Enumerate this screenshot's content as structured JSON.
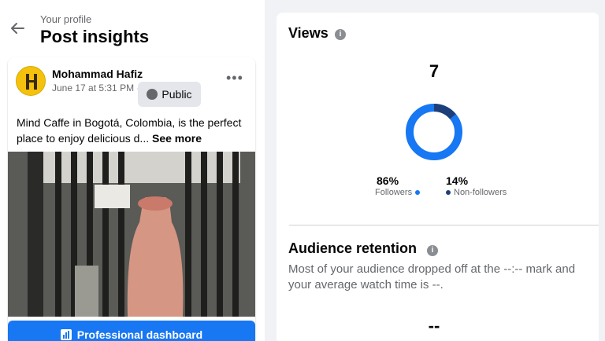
{
  "header": {
    "subtitle": "Your profile",
    "title": "Post insights"
  },
  "post": {
    "author": "Mohammad Hafiz",
    "date": "June 17 at 5:31 PM",
    "separator": "·",
    "audience": "Public",
    "text": "Mind Caffe in Bogotá, Colombia, is the perfect place to enjoy delicious d...",
    "see_more": "See more",
    "sign_text": "PUERTA DE\nCAFECITO"
  },
  "dashboard_button": {
    "label": "Professional dashboard"
  },
  "views": {
    "title": "Views",
    "total": "7",
    "followers_pct": "86%",
    "followers_label": "Followers",
    "non_followers_pct": "14%",
    "non_followers_label": "Non-followers",
    "colors": {
      "followers": "#1877f2",
      "non_followers": "#1c3f7a"
    }
  },
  "chart_data": {
    "type": "pie",
    "categories": [
      "Followers",
      "Non-followers"
    ],
    "values": [
      86,
      14
    ]
  },
  "retention": {
    "title": "Audience retention",
    "text": "Most of your audience dropped off at the --:-- mark and your average watch time is --.",
    "value": "--"
  }
}
